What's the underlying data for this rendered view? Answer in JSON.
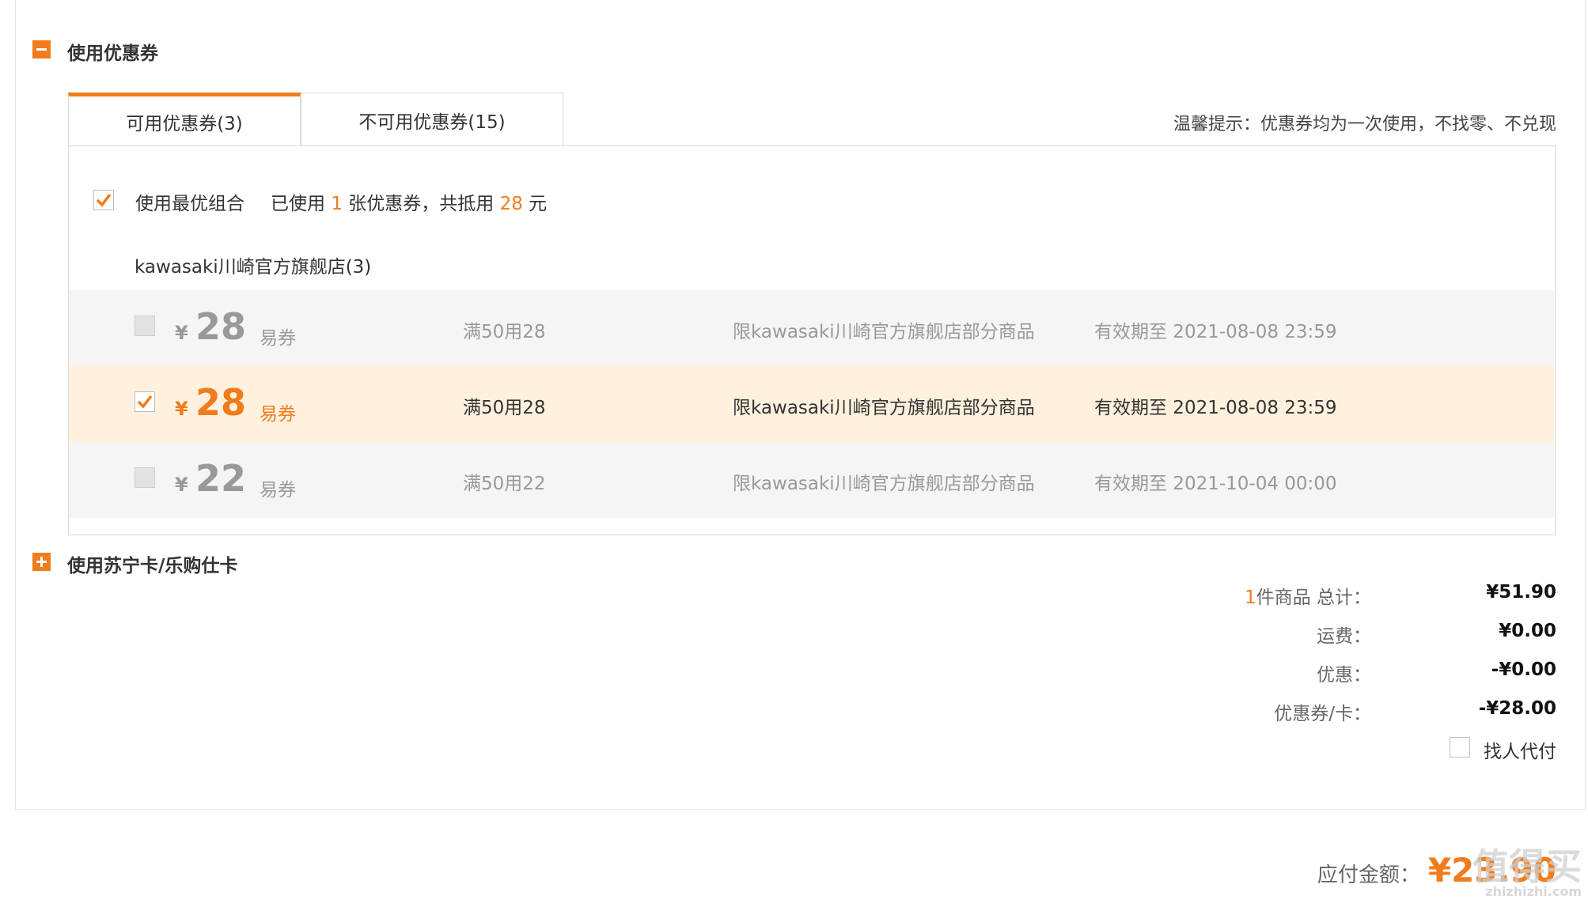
{
  "coupon_section": {
    "title": "使用优惠券",
    "tabs": [
      {
        "label": "可用优惠券(3)",
        "active": true
      },
      {
        "label": "不可用优惠券(15)",
        "active": false
      }
    ],
    "tip": "温馨提示：优惠券均为一次使用，不找零、不兑现",
    "best_combo": {
      "label": "使用最优组合",
      "summary_prefix": "已使用",
      "used_count": "1",
      "summary_middle": "张优惠券，共抵用",
      "discount": "28",
      "summary_suffix": "元"
    },
    "store_name": "kawasaki川崎官方旗舰店(3)",
    "coupons": [
      {
        "currency": "¥",
        "amount": "28",
        "type": "易券",
        "condition": "满50用28",
        "scope": "限kawasaki川崎官方旗舰店部分商品",
        "validity": "有效期至 2021-08-08 23:59",
        "checked": false
      },
      {
        "currency": "¥",
        "amount": "28",
        "type": "易券",
        "condition": "满50用28",
        "scope": "限kawasaki川崎官方旗舰店部分商品",
        "validity": "有效期至 2021-08-08 23:59",
        "checked": true
      },
      {
        "currency": "¥",
        "amount": "22",
        "type": "易券",
        "condition": "满50用22",
        "scope": "限kawasaki川崎官方旗舰店部分商品",
        "validity": "有效期至 2021-10-04 00:00",
        "checked": false
      }
    ]
  },
  "card_section": {
    "title": "使用苏宁卡/乐购仕卡"
  },
  "summary": {
    "item_count": "1",
    "items_label": "件商品 总计：",
    "items_value": "¥51.90",
    "shipping_label": "运费：",
    "shipping_value": "¥0.00",
    "discount_label": "优惠：",
    "discount_value": "-¥0.00",
    "coupon_label": "优惠券/卡：",
    "coupon_value": "-¥28.00",
    "pay_for_me_label": "找人代付"
  },
  "payable": {
    "label": "应付金额：",
    "value": "¥23.90"
  },
  "watermark": {
    "logo": "值得买",
    "site": "zhizhizhi.com"
  },
  "colors": {
    "accent": "#f07c1c",
    "selected_row": "#fff1de",
    "disabled_row": "#f5f5f5",
    "border": "#d9d9d9"
  }
}
